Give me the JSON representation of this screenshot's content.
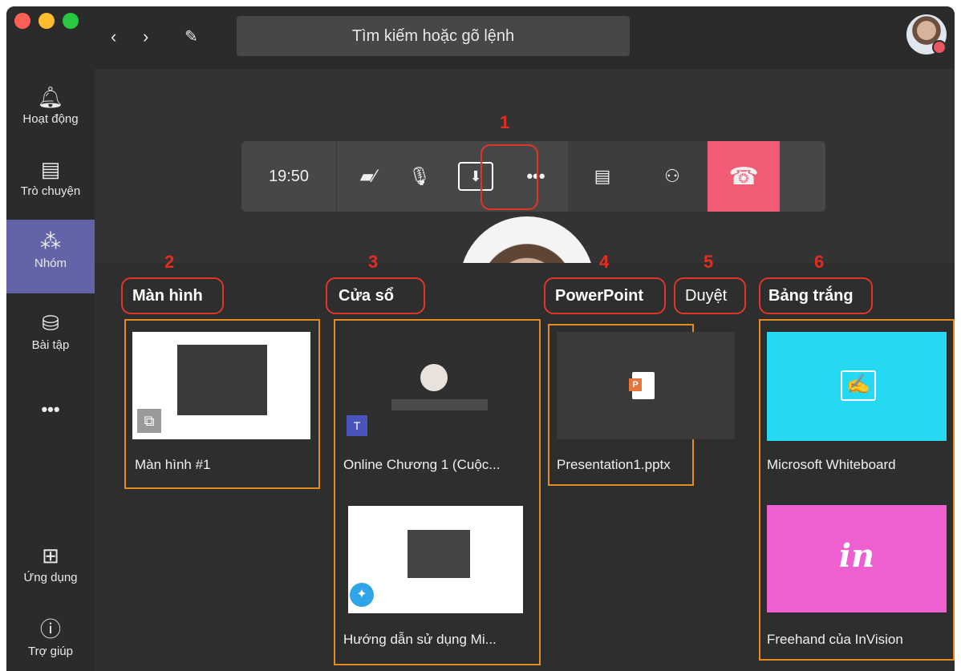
{
  "app": {
    "search_placeholder": "Tìm kiếm hoặc gõ lệnh",
    "rail": [
      {
        "label": "Hoạt động",
        "icon": "bell-icon"
      },
      {
        "label": "Trò chuyện",
        "icon": "chat-icon"
      },
      {
        "label": "Nhóm",
        "icon": "teams-icon",
        "active": true
      },
      {
        "label": "Bài tập",
        "icon": "backpack-icon"
      },
      {
        "label": "•••",
        "icon": "more-icon"
      },
      {
        "label": "Ứng dụng",
        "icon": "apps-icon"
      },
      {
        "label": "Trợ giúp",
        "icon": "help-icon"
      }
    ]
  },
  "meeting": {
    "time": "19:50",
    "hang_color": "#f25b76"
  },
  "annotations": [
    "1",
    "2",
    "3",
    "4",
    "5",
    "6"
  ],
  "share": {
    "sections": {
      "screen": "Màn hình",
      "window": "Cửa sổ",
      "powerpoint": "PowerPoint",
      "browse": "Duyệt",
      "whiteboard": "Bảng trắng"
    },
    "items": {
      "screen1": "Màn hình #1",
      "window1": "Online Chương 1 (Cuộc...",
      "window2": "Hướng dẫn sử dụng Mi...",
      "ppt1": "Presentation1.pptx",
      "wb1": "Microsoft Whiteboard",
      "wb2": "Freehand của InVision"
    }
  }
}
